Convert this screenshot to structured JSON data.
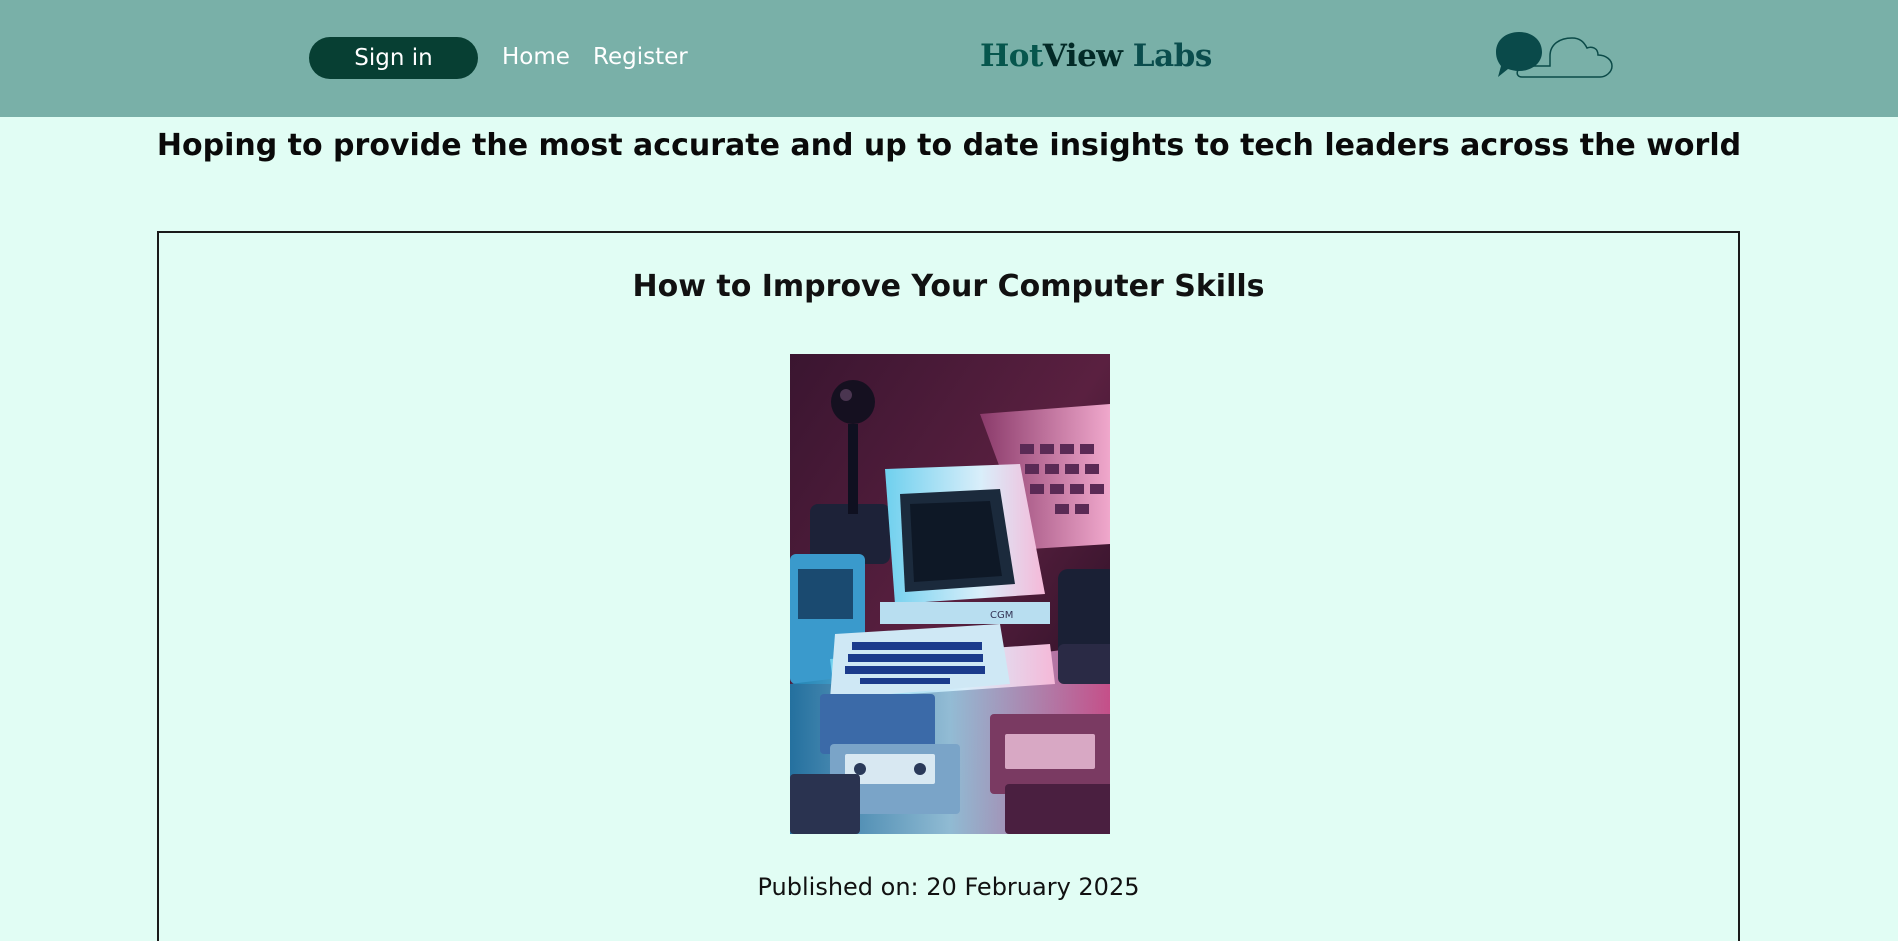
{
  "header": {
    "signin_label": "Sign in",
    "nav": [
      {
        "label": "Home"
      },
      {
        "label": "Register"
      }
    ],
    "logo": {
      "part1": "Hot",
      "part2": "View",
      "part3": " Labs"
    },
    "icon": "chat-bubbles-icon"
  },
  "tagline": "Hoping to provide the most accurate and up to date insights to tech leaders across the world",
  "article": {
    "title": "How to Improve Your Computer Skills",
    "image": "retro-computer-photo",
    "published": "Published on: 20 February 2025"
  },
  "colors": {
    "header_bg": "#79b0a8",
    "page_bg": "#e1fdf4",
    "signin_bg": "#073f33",
    "logo_dark": "#032a27",
    "logo_teal": "#06564d"
  }
}
